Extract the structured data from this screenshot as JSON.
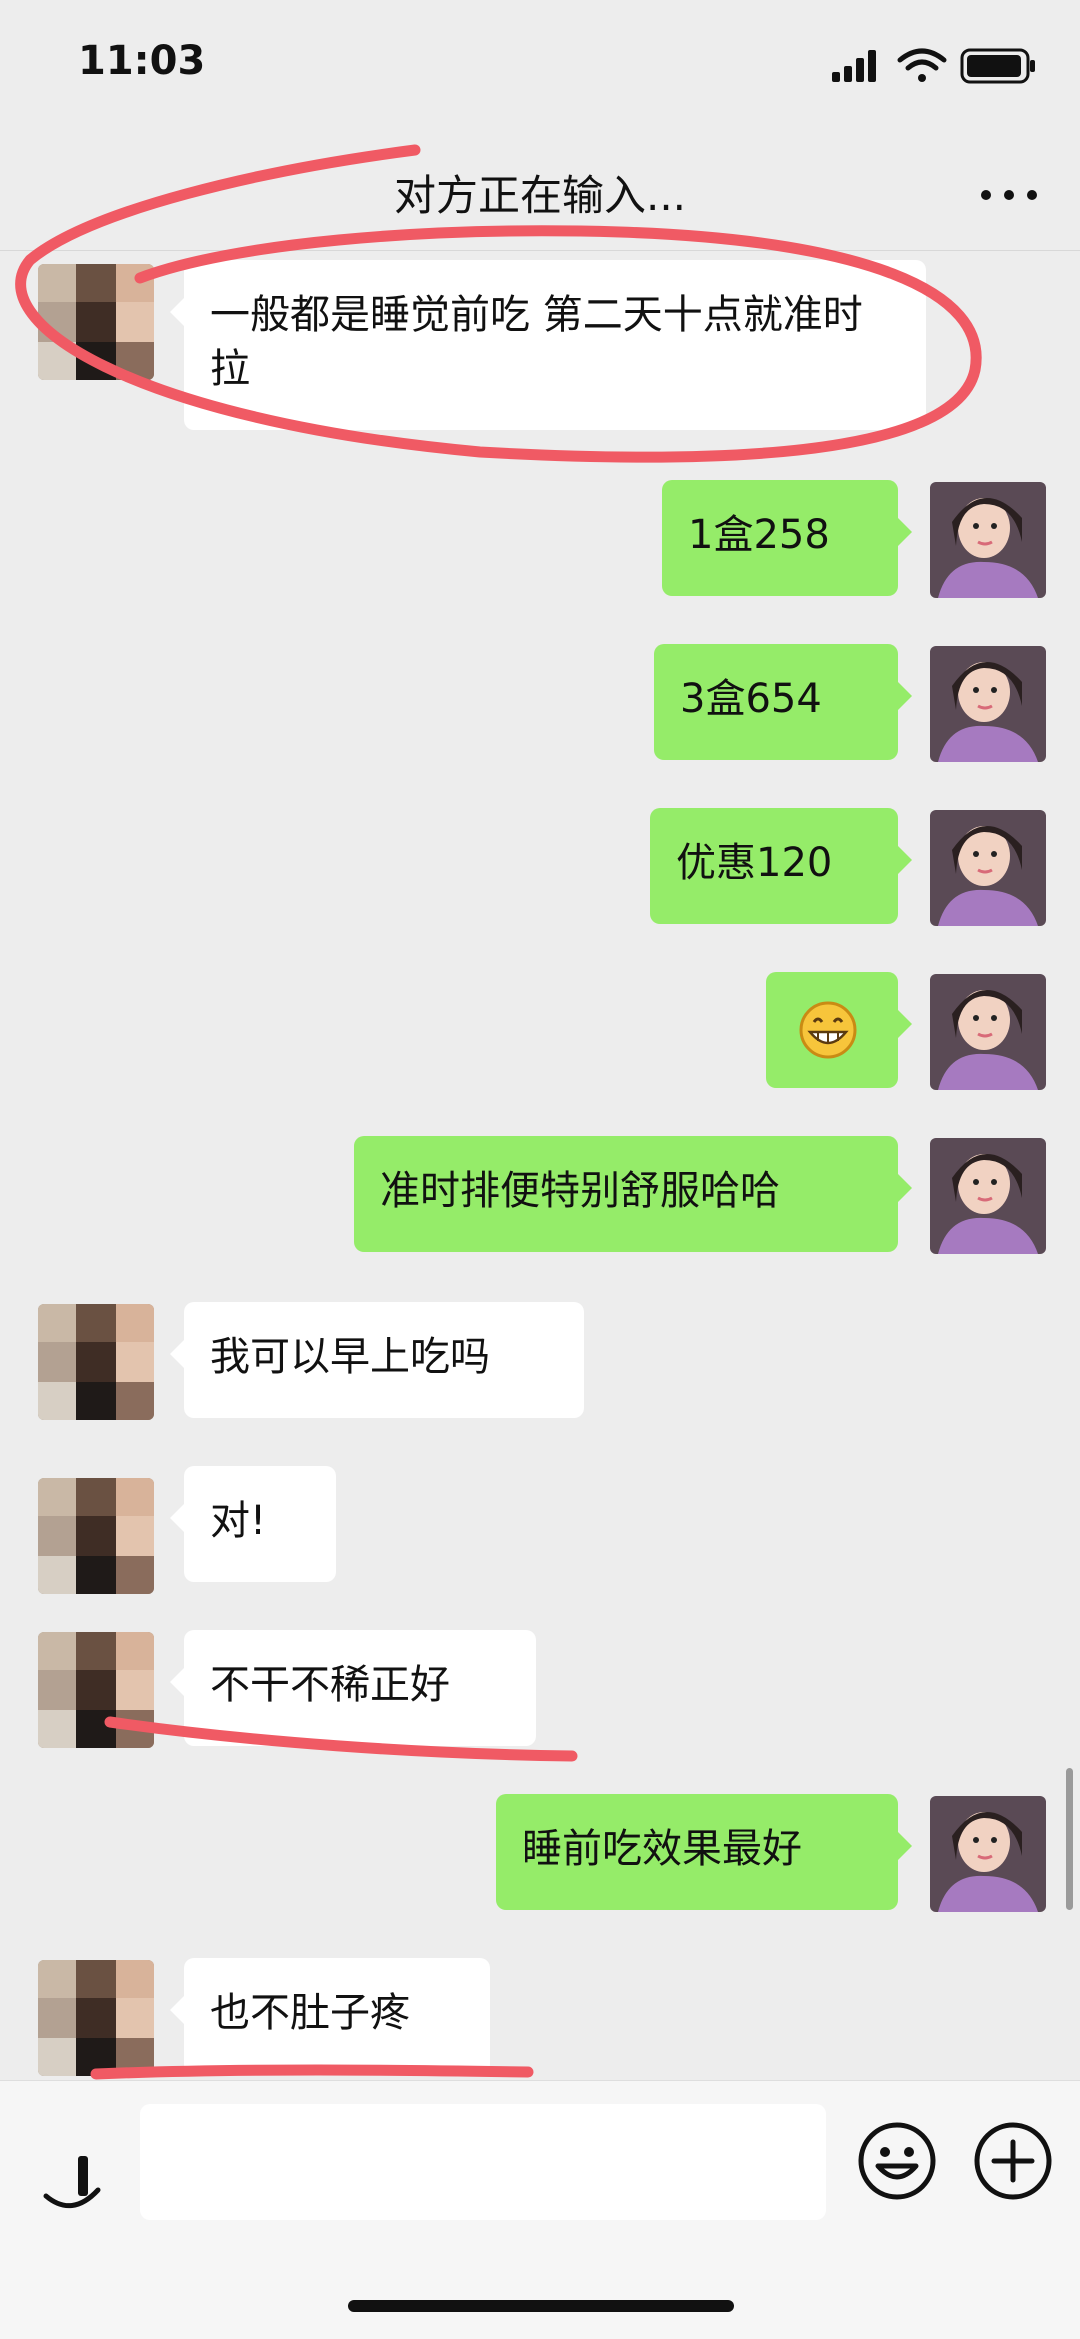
{
  "status": {
    "time": "11:03"
  },
  "header": {
    "title": "对方正在输入..."
  },
  "messages": [
    {
      "side": "in",
      "text": "一般都是睡觉前吃 第二天十点就准时拉"
    },
    {
      "side": "out",
      "text": "1盒258"
    },
    {
      "side": "out",
      "text": "3盒654"
    },
    {
      "side": "out",
      "text": "优惠120"
    },
    {
      "side": "out",
      "text": "😁"
    },
    {
      "side": "out",
      "text": "准时排便特别舒服哈哈"
    },
    {
      "side": "in",
      "text": "我可以早上吃吗"
    },
    {
      "side": "in",
      "text": "对!"
    },
    {
      "side": "in",
      "text": "不干不稀正好"
    },
    {
      "side": "out",
      "text": "睡前吃效果最好"
    },
    {
      "side": "in",
      "text": "也不肚子疼"
    }
  ],
  "input": {
    "placeholder": ""
  },
  "icons": {
    "signal": "signal-icon",
    "wifi": "wifi-icon",
    "battery": "battery-icon",
    "more": "more-icon",
    "voice": "voice-icon",
    "emoji": "emoji-icon",
    "plus": "plus-icon"
  },
  "colors": {
    "background": "#ededed",
    "outgoing_bubble": "#95ec69",
    "incoming_bubble": "#ffffff",
    "annotation": "#f05a64"
  }
}
